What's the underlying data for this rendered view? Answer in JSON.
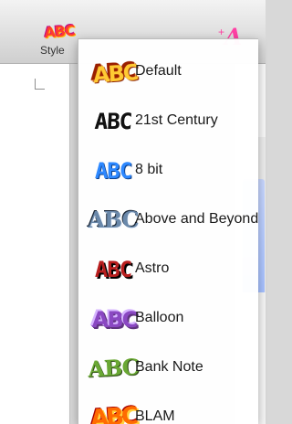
{
  "toolbar": {
    "style_label": "Style",
    "style_icon_text": "ABC",
    "text_tool_icon": "A",
    "text_tool_mark": "+"
  },
  "menu": {
    "items": [
      {
        "preview": "ABC",
        "label": "Default"
      },
      {
        "preview": "ABC",
        "label": "21st Century"
      },
      {
        "preview": "ABC",
        "label": "8 bit"
      },
      {
        "preview": "ABC",
        "label": "Above and Beyond"
      },
      {
        "preview": "ABC",
        "label": "Astro"
      },
      {
        "preview": "ABC",
        "label": "Balloon"
      },
      {
        "preview": "ABC",
        "label": "Bank Note"
      },
      {
        "preview": "ABC",
        "label": "BLAM"
      }
    ]
  }
}
